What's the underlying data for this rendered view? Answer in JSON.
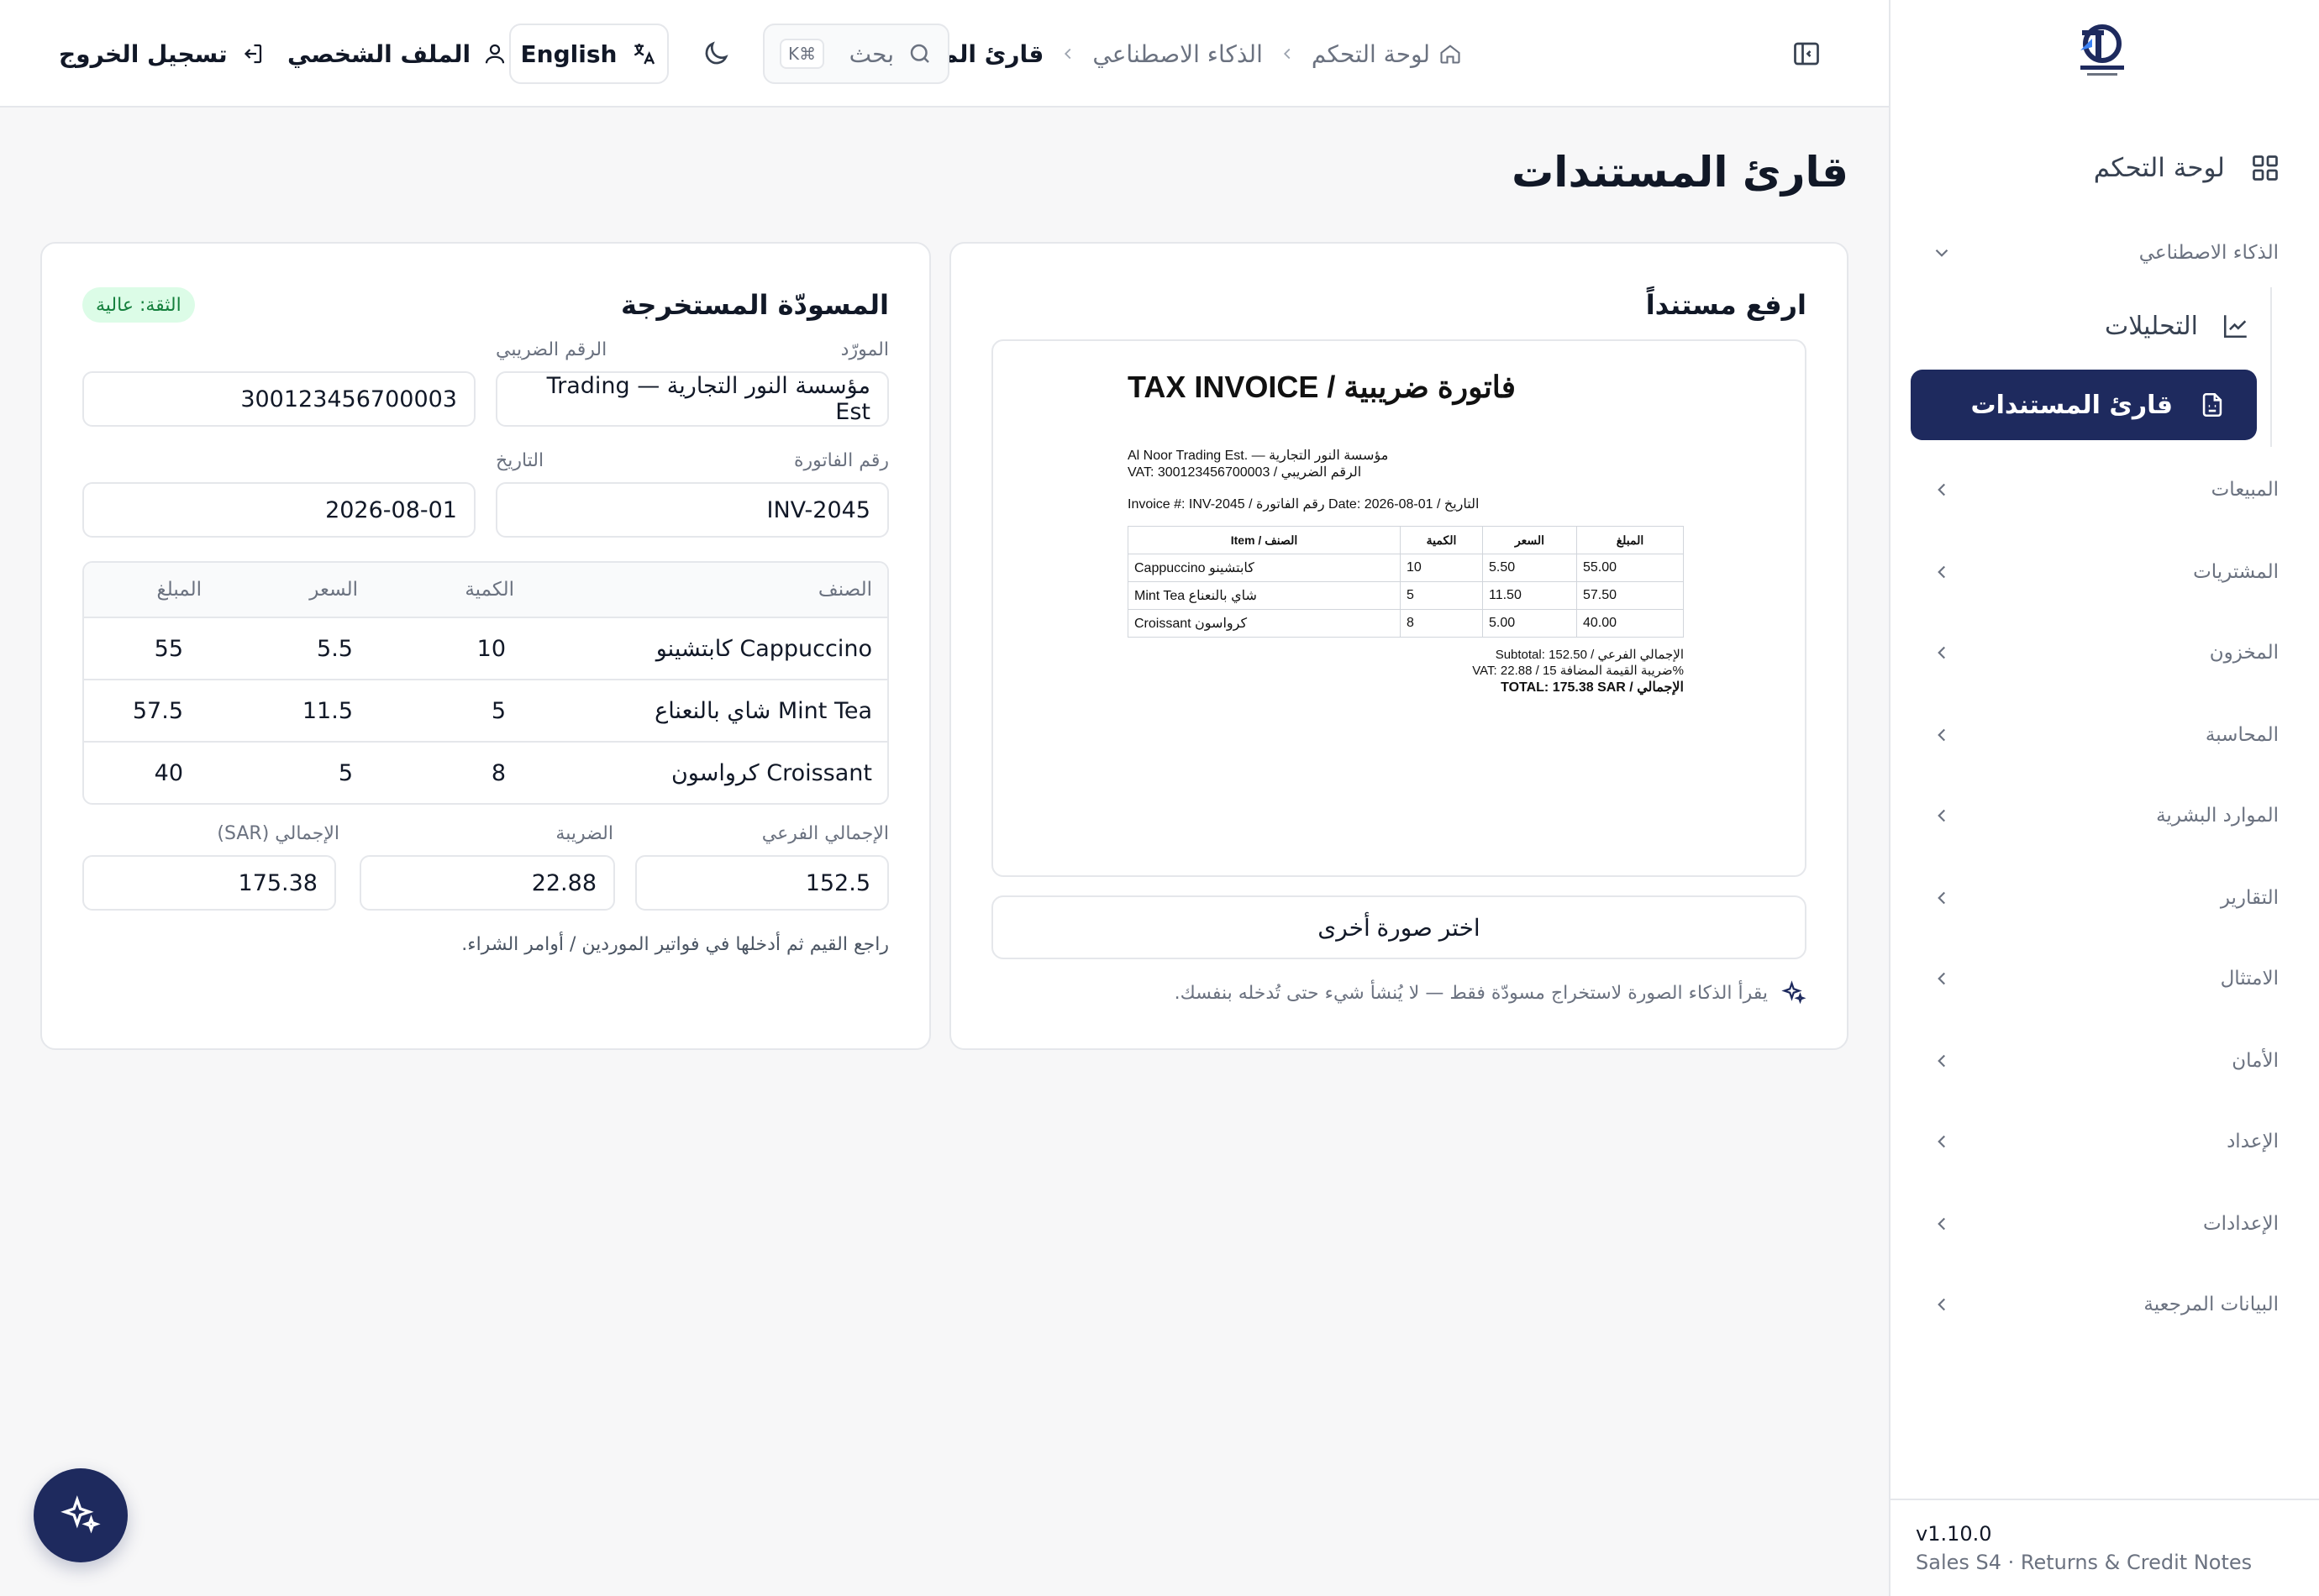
{
  "colors": {
    "brand": "#1e2a5e",
    "success_bg": "#dcfce7",
    "success_text": "#15803d"
  },
  "sidebar": {
    "dashboard": "لوحة التحكم",
    "ai_section": "الذكاء الاصطناعي",
    "analytics": "التحليلات",
    "document_reader": "قارئ المستندات",
    "sections": [
      "المبيعات",
      "المشتريات",
      "المخزون",
      "المحاسبة",
      "الموارد البشرية",
      "التقارير",
      "الامتثال",
      "الأمان",
      "الإعداد",
      "الإعدادات",
      "البيانات المرجعية"
    ],
    "version": "v1.10.0",
    "release": "Sales S4 · Returns & Credit Notes"
  },
  "header": {
    "breadcrumb": [
      "لوحة التحكم",
      "الذكاء الاصطناعي",
      "قارئ المستندات"
    ],
    "search_placeholder": "بحث",
    "search_shortcut": "⌘K",
    "language": "English",
    "profile": "الملف الشخصي",
    "logout": "تسجيل الخروج"
  },
  "page": {
    "title": "قارئ المستندات"
  },
  "upload": {
    "title": "ارفع مستنداً",
    "choose_button": "اختر صورة أخرى",
    "note": "يقرأ الذكاء الصورة لاستخراج مسودّة فقط — لا يُنشأ شيء حتى تُدخله بنفسك."
  },
  "invoice_image": {
    "title": "TAX INVOICE / فاتورة ضريبية",
    "seller": "Al Noor Trading Est. — مؤسسة النور التجارية",
    "vat": "VAT: 300123456700003 / الرقم الضريبي",
    "meta": "Invoice #: INV-2045 / رقم الفاتورة    Date: 2026-08-01 / التاريخ",
    "headers": [
      "Item / الصنف",
      "الكمية",
      "السعر",
      "المبلغ"
    ],
    "rows": [
      [
        "Cappuccino كابتشينو",
        "10",
        "5.50",
        "55.00"
      ],
      [
        "Mint Tea شاي بالنعناع",
        "5",
        "11.50",
        "57.50"
      ],
      [
        "Croissant كرواسون",
        "8",
        "5.00",
        "40.00"
      ]
    ],
    "subtotal": "Subtotal: 152.50 / الإجمالي الفرعي",
    "vat_line": "VAT: 22.88 / ضريبة القيمة المضافة 15%",
    "total": "TOTAL: 175.38 SAR / الإجمالي"
  },
  "draft": {
    "title": "المسودّة المستخرجة",
    "confidence": "الثقة: عالية",
    "supplier_label": "المورّد",
    "supplier": "مؤسسة النور التجارية — Trading Est",
    "tax_label": "الرقم الضريبي",
    "tax_number": "300123456700003",
    "invoice_label": "رقم الفاتورة",
    "invoice_number": "INV-2045",
    "date_label": "التاريخ",
    "date": "2026-08-01",
    "headers": {
      "item": "الصنف",
      "qty": "الكمية",
      "price": "السعر",
      "amount": "المبلغ"
    },
    "items": [
      {
        "item": "Cappuccino كابتشينو",
        "qty": "10",
        "price": "5.5",
        "amount": "55"
      },
      {
        "item": "Mint Tea شاي بالنعناع",
        "qty": "5",
        "price": "11.5",
        "amount": "57.5"
      },
      {
        "item": "Croissant كرواسون",
        "qty": "8",
        "price": "5",
        "amount": "40"
      }
    ],
    "subtotal_label": "الإجمالي الفرعي",
    "subtotal": "152.5",
    "tax_amount_label": "الضريبة",
    "tax_amount": "22.88",
    "total_label": "الإجمالي (SAR)",
    "total": "175.38",
    "hint": "راجع القيم ثم أدخلها في فواتير الموردين / أوامر الشراء."
  }
}
